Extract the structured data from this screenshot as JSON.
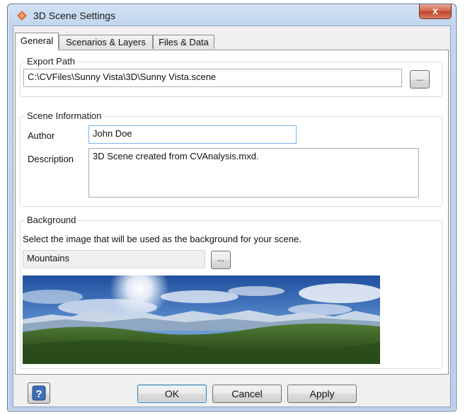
{
  "window": {
    "title": "3D Scene Settings",
    "close_label": "x"
  },
  "tabs": [
    {
      "label": "General",
      "active": true
    },
    {
      "label": "Scenarios & Layers",
      "active": false
    },
    {
      "label": "Files & Data",
      "active": false
    }
  ],
  "export_path": {
    "group_label": "Export Path",
    "value": "C:\\CVFiles\\Sunny Vista\\3D\\Sunny Vista.scene",
    "browse_label": "..."
  },
  "scene_info": {
    "group_label": "Scene Information",
    "author_label": "Author",
    "author_value": "John Doe",
    "description_label": "Description",
    "description_value": "3D Scene created from CVAnalysis.mxd."
  },
  "background": {
    "group_label": "Background",
    "instruction": "Select the image that will be used as the background for your scene.",
    "selected_image": "Mountains",
    "browse_label": "..."
  },
  "footer": {
    "ok_label": "OK",
    "cancel_label": "Cancel",
    "apply_label": "Apply"
  }
}
